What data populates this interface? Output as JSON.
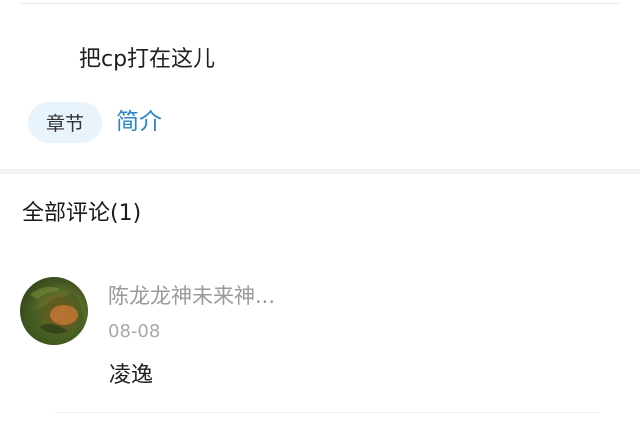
{
  "post": {
    "text": "把cp打在这儿"
  },
  "tabs": [
    {
      "label": "章节"
    },
    {
      "label": "简介"
    }
  ],
  "comments": {
    "header": "全部评论(1)",
    "items": [
      {
        "user": "陈龙龙神未来神...",
        "date": "08-08",
        "body": "凌逸"
      }
    ]
  },
  "colors": {
    "accent": "#2a86c4",
    "chip_bg": "#e8f3fb",
    "muted_text": "#9a9a9a",
    "divider": "#f3f3f3"
  }
}
